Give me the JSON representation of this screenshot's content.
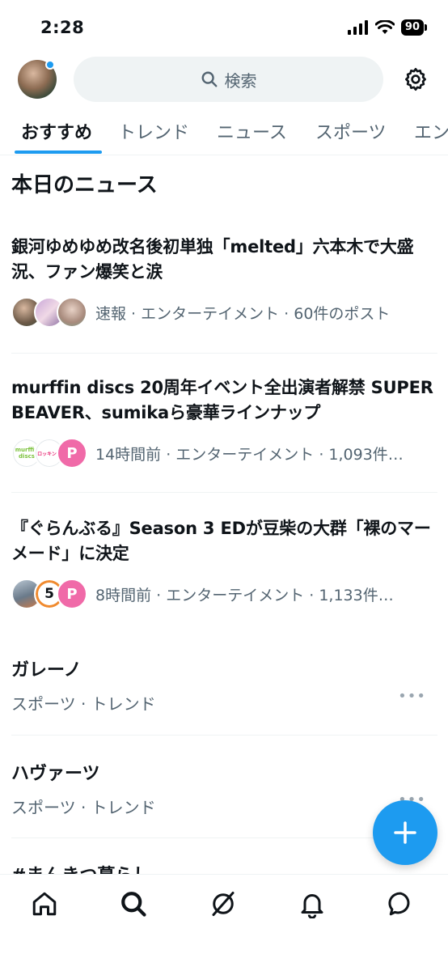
{
  "status_bar": {
    "time": "2:28",
    "battery": "90"
  },
  "header": {
    "search_placeholder": "検索"
  },
  "tabs": [
    {
      "label": "おすすめ"
    },
    {
      "label": "トレンド"
    },
    {
      "label": "ニュース"
    },
    {
      "label": "スポーツ"
    },
    {
      "label": "エン"
    }
  ],
  "section_title": "本日のニュース",
  "news": [
    {
      "headline": "銀河ゆめゆめ改名後初単独「melted」六本木で大盛況、ファン爆笑と涙",
      "meta": "速報 · エンターテイメント · 60件のポスト"
    },
    {
      "headline": "murffin discs 20周年イベント全出演者解禁 SUPER BEAVER、sumikaら豪華ラインナップ",
      "meta": "14時間前 · エンターテイメント · 1,093件…",
      "avatar_labels": [
        "murffin discs",
        "ロッキング"
      ]
    },
    {
      "headline": "『ぐらんぶる』Season 3 EDが豆柴の大群「裸のマーメード」に決定",
      "meta": "8時間前 · エンターテイメント · 1,133件…",
      "avatar_labels": [
        "5"
      ]
    }
  ],
  "trends": [
    {
      "name": "ガレーノ",
      "meta": "スポーツ · トレンド",
      "more": "•••"
    },
    {
      "name": "ハヴァーツ",
      "meta": "スポーツ · トレンド",
      "more": "•••"
    },
    {
      "name": "#まんきつ暮らし",
      "meta": ""
    }
  ],
  "colors": {
    "accent": "#1d9bf0",
    "text": "#0f1419",
    "secondary": "#536471"
  },
  "icons": {
    "header": [
      "avatar",
      "search-icon",
      "gear-icon"
    ],
    "bottom_nav": [
      "home-icon",
      "search-icon",
      "grok-icon",
      "bell-icon",
      "message-icon"
    ],
    "fab": "plus-icon"
  }
}
